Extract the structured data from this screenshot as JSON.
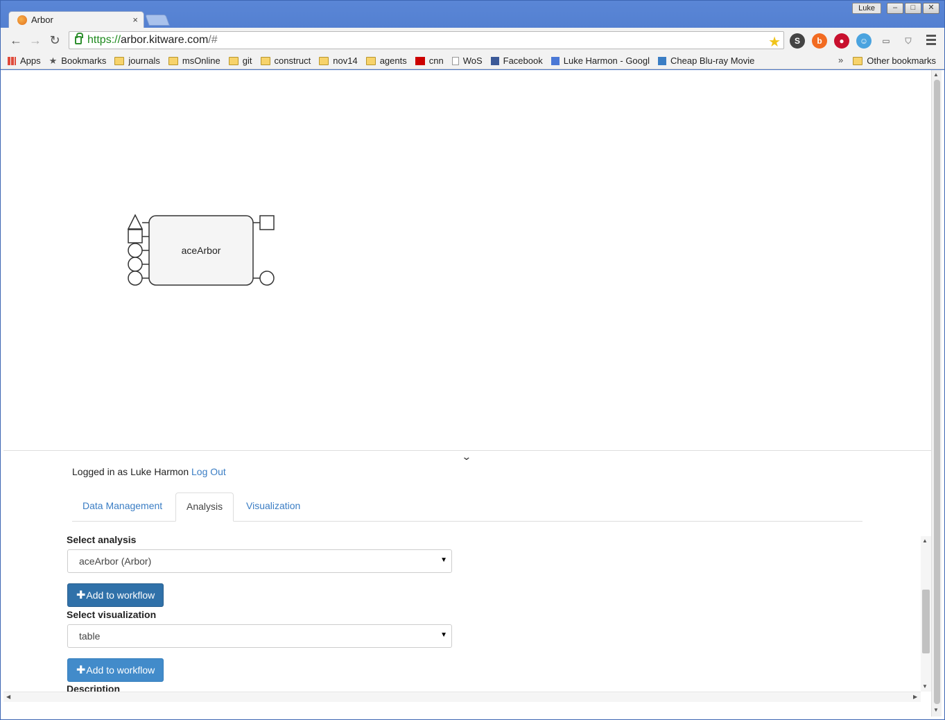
{
  "browser": {
    "tab_title": "Arbor",
    "tab_close": "×",
    "window_user": "Luke",
    "url_scheme": "https://",
    "url_host": "arbor.kitware.com",
    "url_path": "/#",
    "bookmarks": [
      {
        "label": "Apps",
        "icon": "apps-grid-icon"
      },
      {
        "label": "Bookmarks",
        "icon": "star-icon"
      },
      {
        "label": "journals",
        "icon": "folder-icon"
      },
      {
        "label": "msOnline",
        "icon": "folder-icon"
      },
      {
        "label": "git",
        "icon": "folder-icon"
      },
      {
        "label": "construct",
        "icon": "folder-icon"
      },
      {
        "label": "nov14",
        "icon": "folder-icon"
      },
      {
        "label": "agents",
        "icon": "folder-icon"
      },
      {
        "label": "cnn",
        "icon": "cnn-icon"
      },
      {
        "label": "WoS",
        "icon": "page-icon"
      },
      {
        "label": "Facebook",
        "icon": "facebook-icon"
      },
      {
        "label": "Luke Harmon - Googl",
        "icon": "scholar-icon"
      },
      {
        "label": "Cheap Blu-ray Movie",
        "icon": "b-icon"
      }
    ],
    "overflow": "»",
    "other_bookmarks": "Other bookmarks"
  },
  "workflow": {
    "node_label": "aceArbor"
  },
  "panel": {
    "collapse_icon": "chevron-down-icon",
    "logged_in_text": "Logged in as Luke Harmon",
    "logout_label": "Log Out",
    "tabs": [
      {
        "label": "Data Management",
        "active": false
      },
      {
        "label": "Analysis",
        "active": true
      },
      {
        "label": "Visualization",
        "active": false
      }
    ],
    "analysis": {
      "label": "Select analysis",
      "selected": "aceArbor (Arbor)",
      "button": "Add to workflow"
    },
    "visualization": {
      "label": "Select visualization",
      "selected": "table",
      "button": "Add to workflow"
    },
    "description_label": "Description"
  },
  "colors": {
    "link": "#3a7dc4",
    "primary_button": "#428bca",
    "chrome_frame": "#4b78c9"
  }
}
